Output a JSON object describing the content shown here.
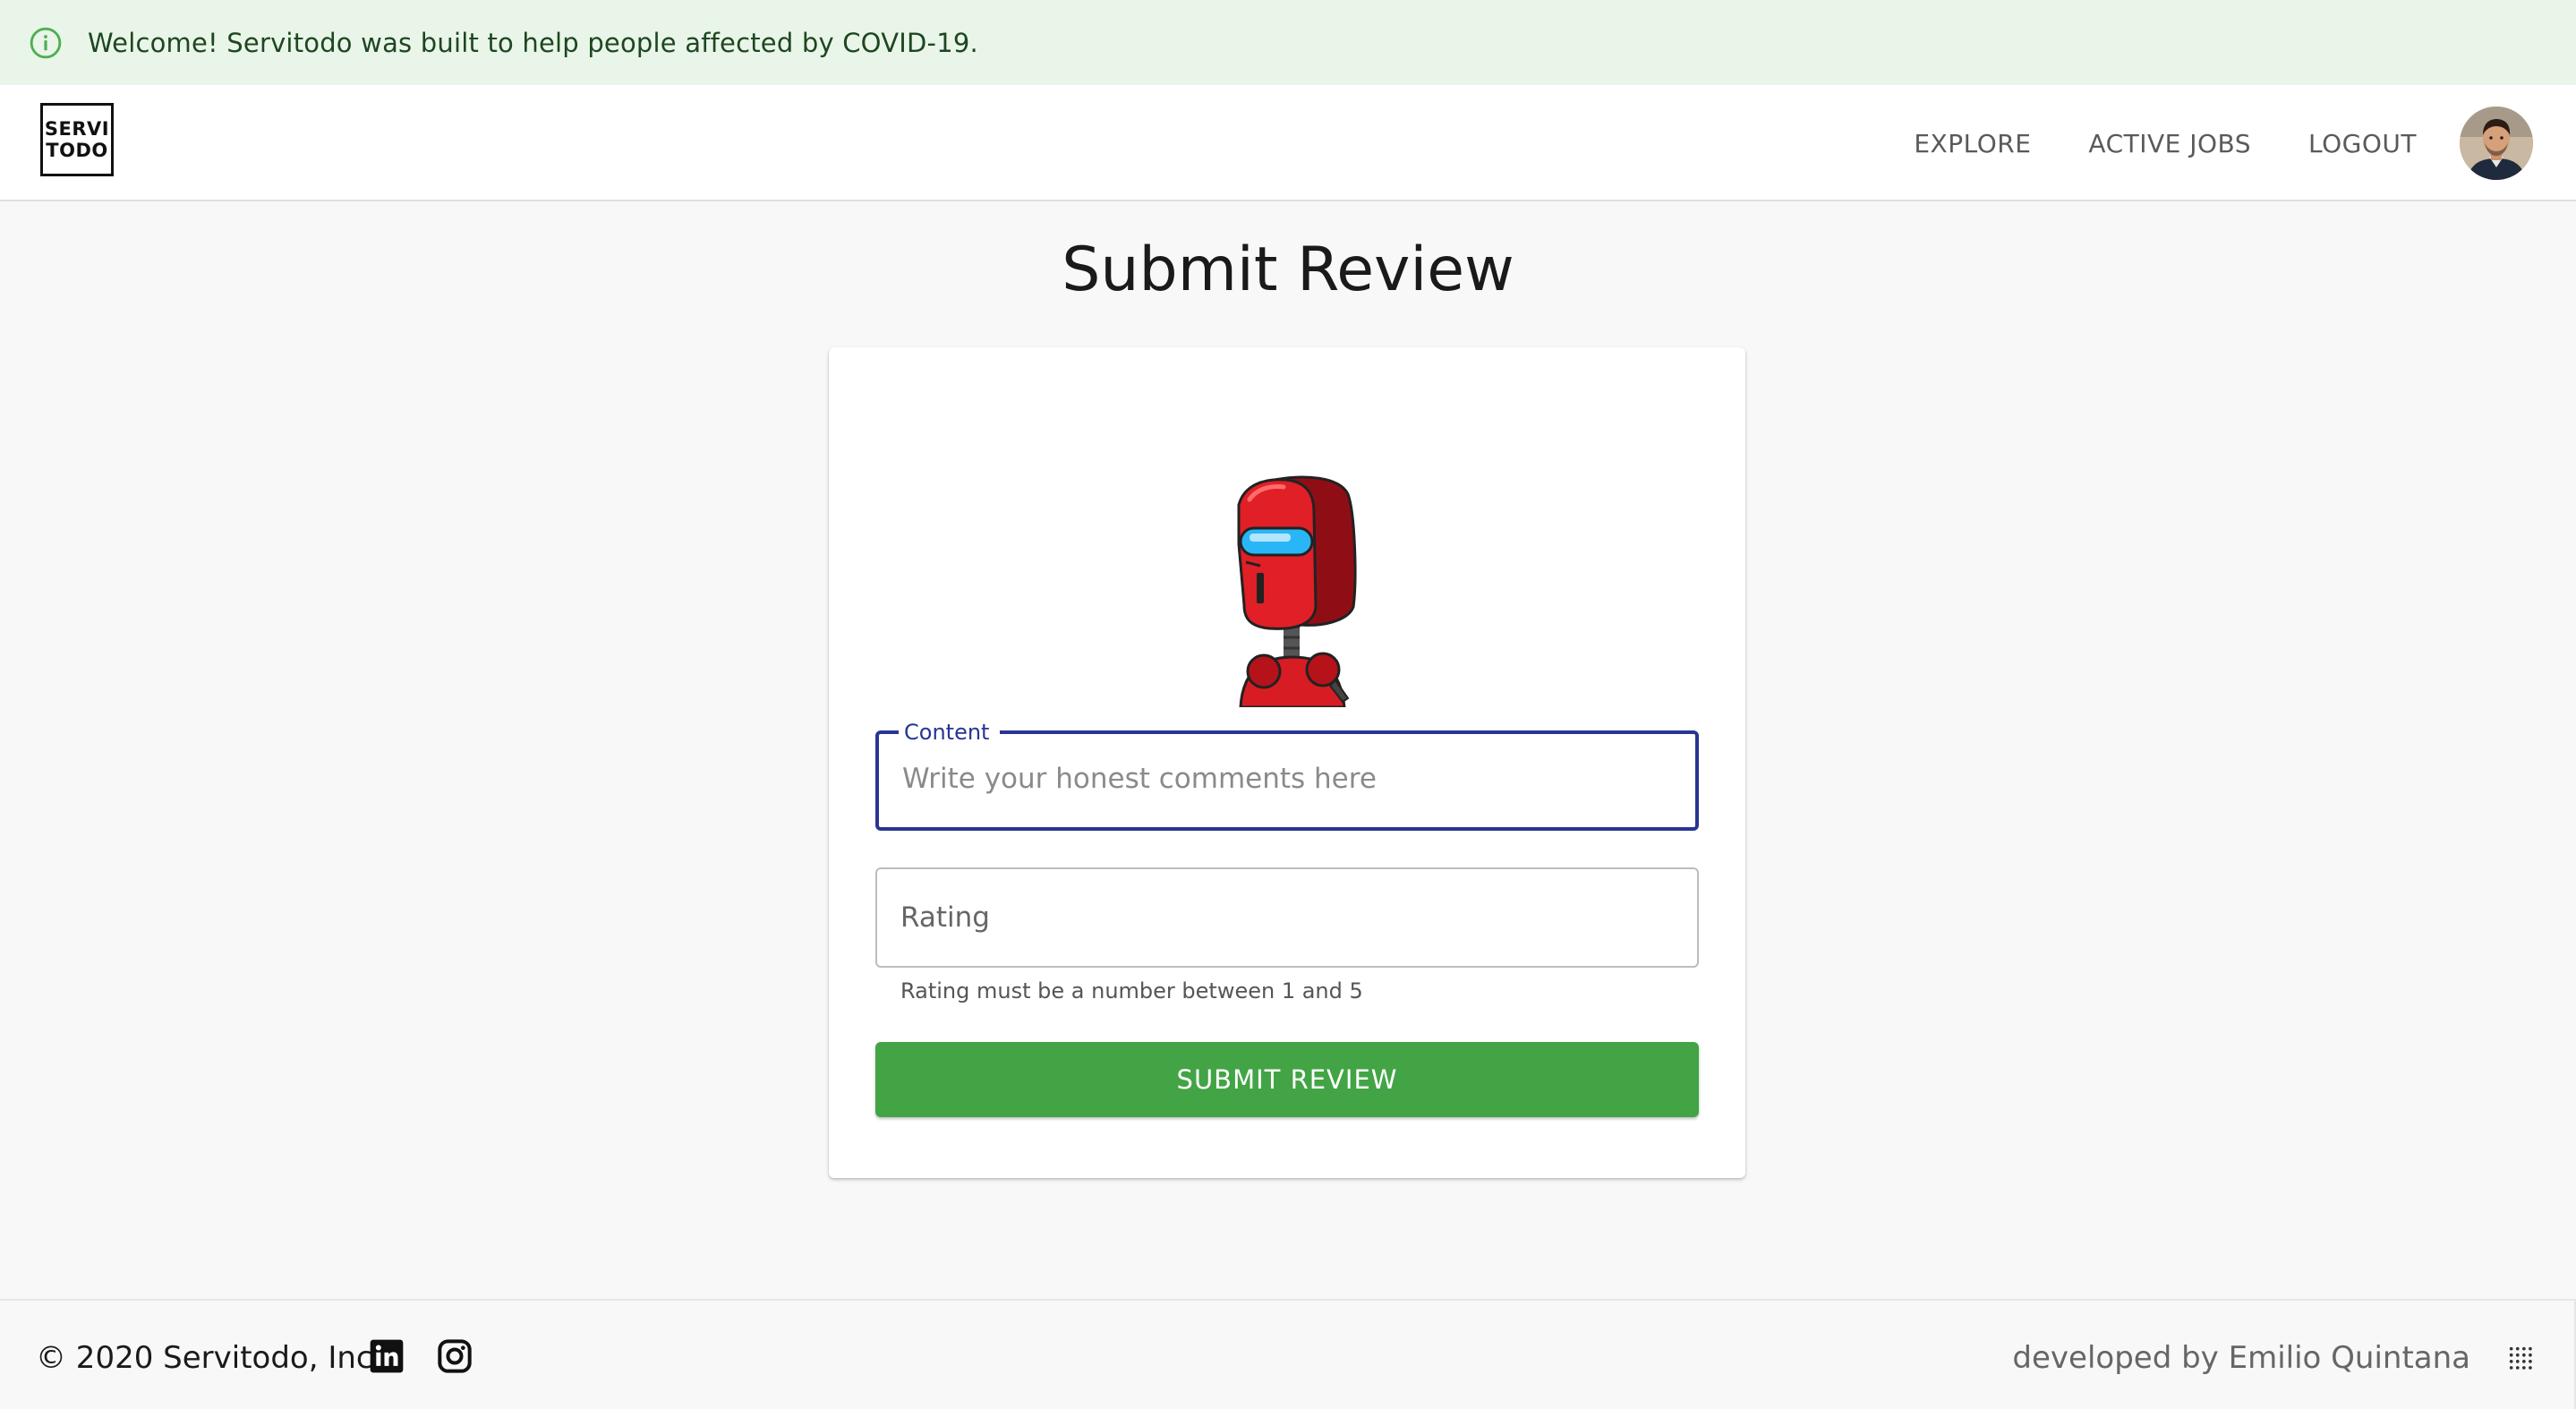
{
  "alert": {
    "icon": "info-icon",
    "text": "Welcome! Servitodo was built to help people affected by COVID-19."
  },
  "header": {
    "logo_line1": "SERVI",
    "logo_line2": "TODO",
    "nav": {
      "explore": "EXPLORE",
      "active_jobs": "ACTIVE JOBS",
      "logout": "LOGOUT"
    },
    "avatar_icon": "user-avatar"
  },
  "page": {
    "title": "Submit Review"
  },
  "form": {
    "illustration": "red-robot-illustration",
    "content": {
      "label": "Content",
      "placeholder": "Write your honest comments here",
      "value": ""
    },
    "rating": {
      "placeholder": "Rating",
      "value": "",
      "helper": "Rating must be a number between 1 and 5"
    },
    "submit_label": "SUBMIT REVIEW"
  },
  "footer": {
    "copyright": "© 2020 Servitodo, Inc",
    "developer": "developed by Emilio Quintana",
    "icons": [
      "linkedin-icon",
      "instagram-icon",
      "dots-grid-icon"
    ]
  },
  "colors": {
    "alert_bg": "#e9f5e9",
    "alert_text": "#1e4620",
    "accent_green": "#43a446",
    "focus_blue": "#283593"
  }
}
